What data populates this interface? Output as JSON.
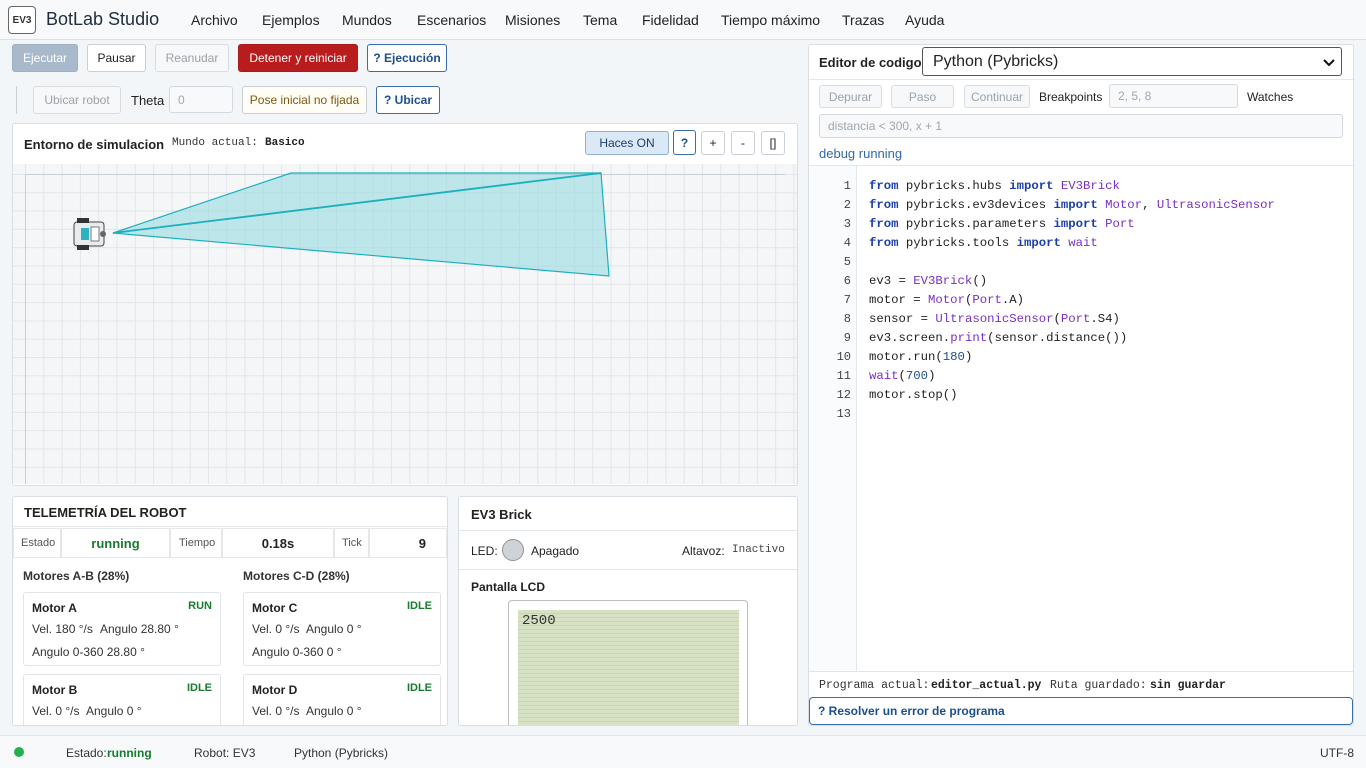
{
  "app": {
    "logo": "EV3",
    "title": "BotLab Studio"
  },
  "menu": [
    "Archivo",
    "Ejemplos",
    "Mundos",
    "Escenarios",
    "Misiones",
    "Tema",
    "Fidelidad",
    "Tiempo máximo",
    "Trazas",
    "Ayuda"
  ],
  "toolbar": {
    "run": "Ejecutar",
    "pause": "Pausar",
    "resume": "Reanudar",
    "stop": "Detener y reiniciar",
    "exec_help": "? Ejecución",
    "locate": "Ubicar robot",
    "theta_label": "Theta",
    "theta_placeholder": "0",
    "pose_unset": "Pose inicial no fijada",
    "locate_help": "? Ubicar"
  },
  "sim": {
    "title": "Entorno de simulacion",
    "world_label": "Mundo actual:",
    "world": "Basico",
    "beams_btn": "Haces ON",
    "help": "?",
    "zoom_in": "+",
    "zoom_out": "-",
    "fit": "[]"
  },
  "telemetry": {
    "title": "TELEMETRÍA DEL ROBOT",
    "estado_label": "Estado",
    "estado": "running",
    "tiempo_label": "Tiempo",
    "tiempo": "0.18s",
    "tick_label": "Tick",
    "tick": "9",
    "group_ab": "Motores A-B (28%)",
    "group_cd": "Motores C-D (28%)",
    "motors": [
      {
        "name": "Motor A",
        "state": "RUN",
        "vel": "Vel. 180 °/s",
        "ang": "Angulo 28.80 °",
        "ang360": "Angulo 0-360 28.80 °"
      },
      {
        "name": "Motor C",
        "state": "IDLE",
        "vel": "Vel. 0 °/s",
        "ang": "Angulo 0 °",
        "ang360": "Angulo 0-360 0 °"
      },
      {
        "name": "Motor B",
        "state": "IDLE",
        "vel": "Vel. 0 °/s",
        "ang": "Angulo 0 °"
      },
      {
        "name": "Motor D",
        "state": "IDLE",
        "vel": "Vel. 0 °/s",
        "ang": "Angulo 0 °"
      }
    ],
    "state_colors": {
      "run": "#1a7a2f",
      "idle": "#1a7a2f"
    }
  },
  "brick": {
    "title": "EV3 Brick",
    "led_label": "LED:",
    "led_state": "Apagado",
    "speaker_label": "Altavoz:",
    "speaker_state": "Inactivo",
    "lcd_title": "Pantalla LCD",
    "lcd_text": "2500"
  },
  "editor": {
    "title": "Editor de codigo",
    "language": "Python (Pybricks)",
    "debug": "Depurar",
    "step": "Paso",
    "continue": "Continuar",
    "breakpoints_label": "Breakpoints",
    "breakpoints_placeholder": "2, 5, 8",
    "watches_label": "Watches",
    "watches_placeholder": "distancia < 300, x + 1",
    "debug_status": "debug running",
    "line_numbers": [
      "1",
      "2",
      "3",
      "4",
      "5",
      "6",
      "7",
      "8",
      "9",
      "10",
      "11",
      "12",
      "13"
    ],
    "code_lines": [
      "from pybricks.hubs import EV3Brick",
      "from pybricks.ev3devices import Motor, UltrasonicSensor",
      "from pybricks.parameters import Port",
      "from pybricks.tools import wait",
      "",
      "ev3 = EV3Brick()",
      "motor = Motor(Port.A)",
      "sensor = UltrasonicSensor(Port.S4)",
      "ev3.screen.print(sensor.distance())",
      "motor.run(180)",
      "wait(700)",
      "motor.stop()",
      ""
    ],
    "program_label": "Programa actual:",
    "program": "editor_actual.py",
    "save_label": "Ruta guardado:",
    "save": "sin guardar",
    "resolve": "? Resolver un error de programa"
  },
  "status": {
    "estado_label": "Estado:",
    "estado": "running",
    "robot": "Robot: EV3",
    "lang": "Python (Pybricks)",
    "encoding": "UTF-8",
    "dot_color": "#22b14c"
  }
}
